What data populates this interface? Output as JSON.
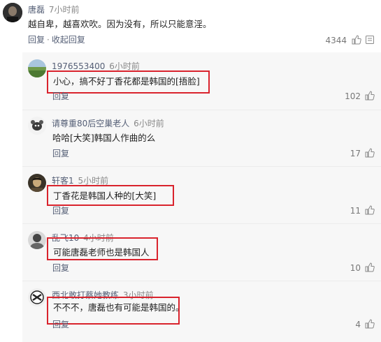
{
  "top_comment": {
    "username": "唐磊",
    "time": "7小时前",
    "text": "越自卑，越喜欢吹。因为没有，所以只能意淫。",
    "reply_label": "回复",
    "collapse_label": "收起回复",
    "likes": "4344"
  },
  "replies": [
    {
      "username": "1976553400",
      "time": "6小时前",
      "text": "小心，搞不好丁香花都是韩国的[捂脸]",
      "reply_label": "回复",
      "likes": "102",
      "highlighted": true
    },
    {
      "username": "请尊重80后空巢老人",
      "time": "6小时前",
      "text": "哈哈[大笑]韩国人作曲的么",
      "reply_label": "回复",
      "likes": "17",
      "highlighted": false
    },
    {
      "username": "轩客1",
      "time": "5小时前",
      "text": "丁香花是韩国人种的[大笑]",
      "reply_label": "回复",
      "likes": "11",
      "highlighted": true
    },
    {
      "username": "乱飞10",
      "time": "4小时前",
      "text": "可能唐磊老师也是韩国人",
      "reply_label": "回复",
      "likes": "10",
      "highlighted": true
    },
    {
      "username": "西北敢打蔡她教练",
      "time": "3小时前",
      "text": "不不不，唐磊也有可能是韩国的。",
      "reply_label": "回复",
      "likes": "4",
      "highlighted": true
    }
  ],
  "colors": {
    "highlight_box": "#d9232d",
    "link": "#555f76",
    "muted": "#888888"
  },
  "icons": {
    "like": "thumbs-up-icon"
  }
}
